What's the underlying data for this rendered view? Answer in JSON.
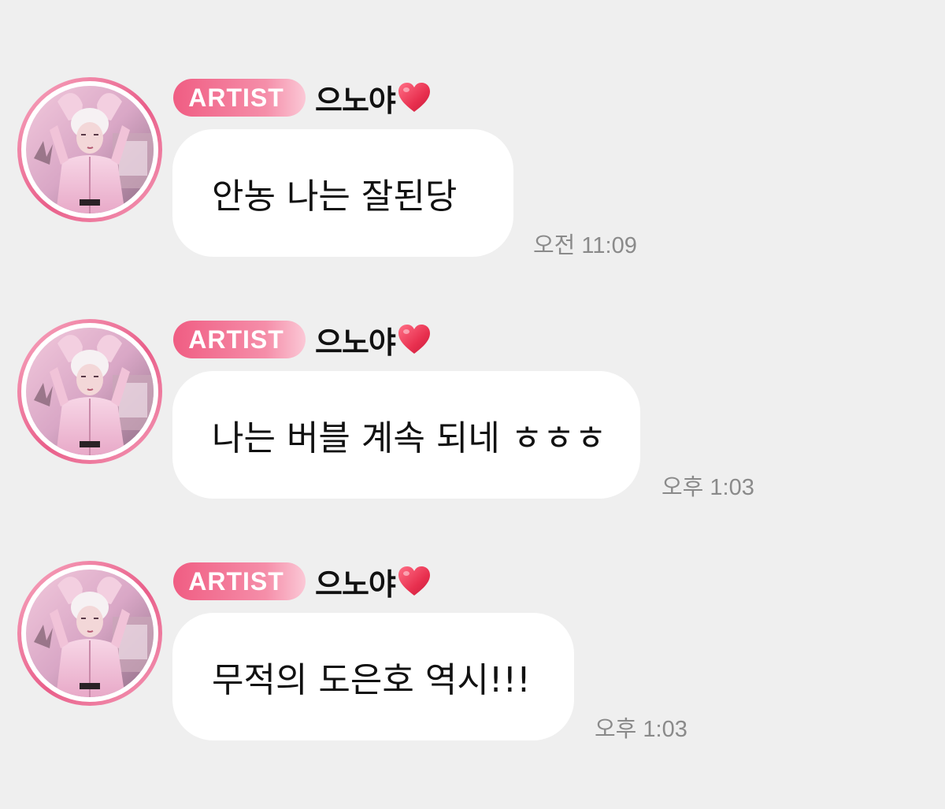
{
  "messages": [
    {
      "badge": "ARTIST",
      "sender": "으노야",
      "text": "안농 나는 잘된당",
      "time": "오전 11:09"
    },
    {
      "badge": "ARTIST",
      "sender": "으노야",
      "text": "나는 버블 계속 되네 ㅎㅎㅎ",
      "time": "오후 1:03"
    },
    {
      "badge": "ARTIST",
      "sender": "으노야",
      "text": "무적의 도은호 역시!!!",
      "time": "오후 1:03"
    }
  ],
  "colors": {
    "background": "#efefef",
    "badge": "#f05d83",
    "bubble": "#ffffff",
    "heart": "#e8304f",
    "timestamp": "#8a8a8a"
  },
  "icons": {
    "heart": "heart-icon",
    "avatar": "avatar"
  }
}
